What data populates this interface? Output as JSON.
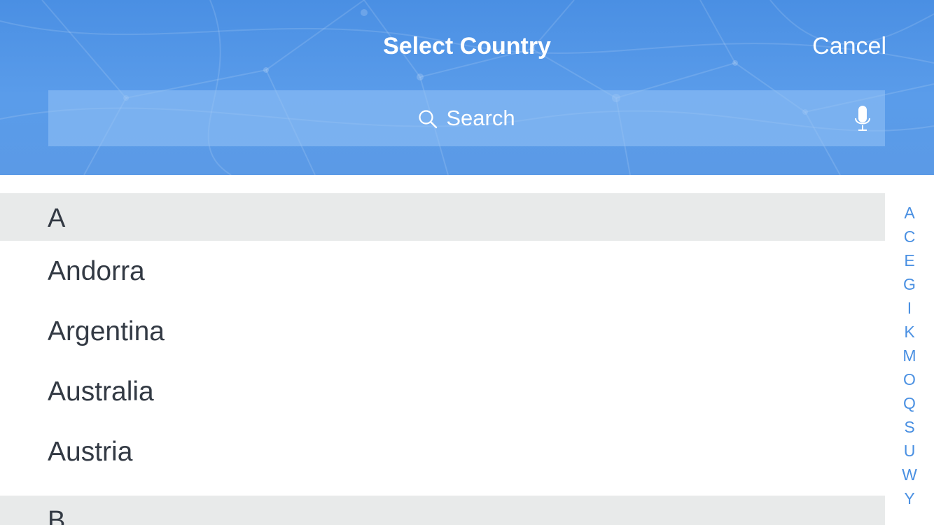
{
  "header": {
    "title": "Select Country",
    "cancel_label": "Cancel"
  },
  "search": {
    "placeholder": "Search",
    "icon": "search-icon",
    "mic_icon": "microphone-icon"
  },
  "sections": [
    {
      "letter": "A",
      "items": [
        "Andorra",
        "Argentina",
        "Australia",
        "Austria"
      ]
    },
    {
      "letter": "B",
      "items": []
    }
  ],
  "index_letters": [
    "A",
    "C",
    "E",
    "G",
    "I",
    "K",
    "M",
    "O",
    "Q",
    "S",
    "U",
    "W",
    "Y"
  ],
  "colors": {
    "header_blue": "#4a8fe3",
    "accent_blue": "#4a90e2",
    "section_bg": "#e8eaea",
    "text_dark": "#333a44"
  }
}
